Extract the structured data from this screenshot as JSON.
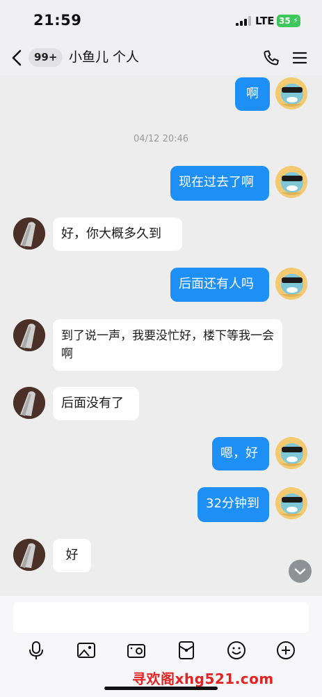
{
  "status_bar": {
    "time": "21:59",
    "network": "LTE",
    "battery": "35"
  },
  "header": {
    "unread_count": "99+",
    "title": "小鱼儿 个人"
  },
  "messages": [
    {
      "side": "out",
      "text": "啊"
    },
    {
      "timestamp": "04/12 20:46"
    },
    {
      "side": "out",
      "text": "现在过去了啊"
    },
    {
      "side": "in",
      "text": "好，你大概多久到"
    },
    {
      "side": "out",
      "text": "后面还有人吗"
    },
    {
      "side": "in",
      "text": "到了说一声，我要没忙好，楼下等我一会啊"
    },
    {
      "side": "in",
      "text": "后面没有了"
    },
    {
      "side": "out",
      "text": "嗯，好"
    },
    {
      "side": "out",
      "text": "32分钟到"
    },
    {
      "side": "in",
      "text": "好"
    }
  ],
  "input": {
    "value": ""
  },
  "toolbar": [
    "mic-icon",
    "image-icon",
    "camera-icon",
    "red-packet-icon",
    "emoji-icon",
    "plus-icon"
  ],
  "watermark": "寻欢阁xhg521.com",
  "colors": {
    "outgoing_bubble": "#1d8ff5",
    "incoming_bubble": "#ffffff",
    "background": "#ededed",
    "battery": "#3cc85a"
  }
}
